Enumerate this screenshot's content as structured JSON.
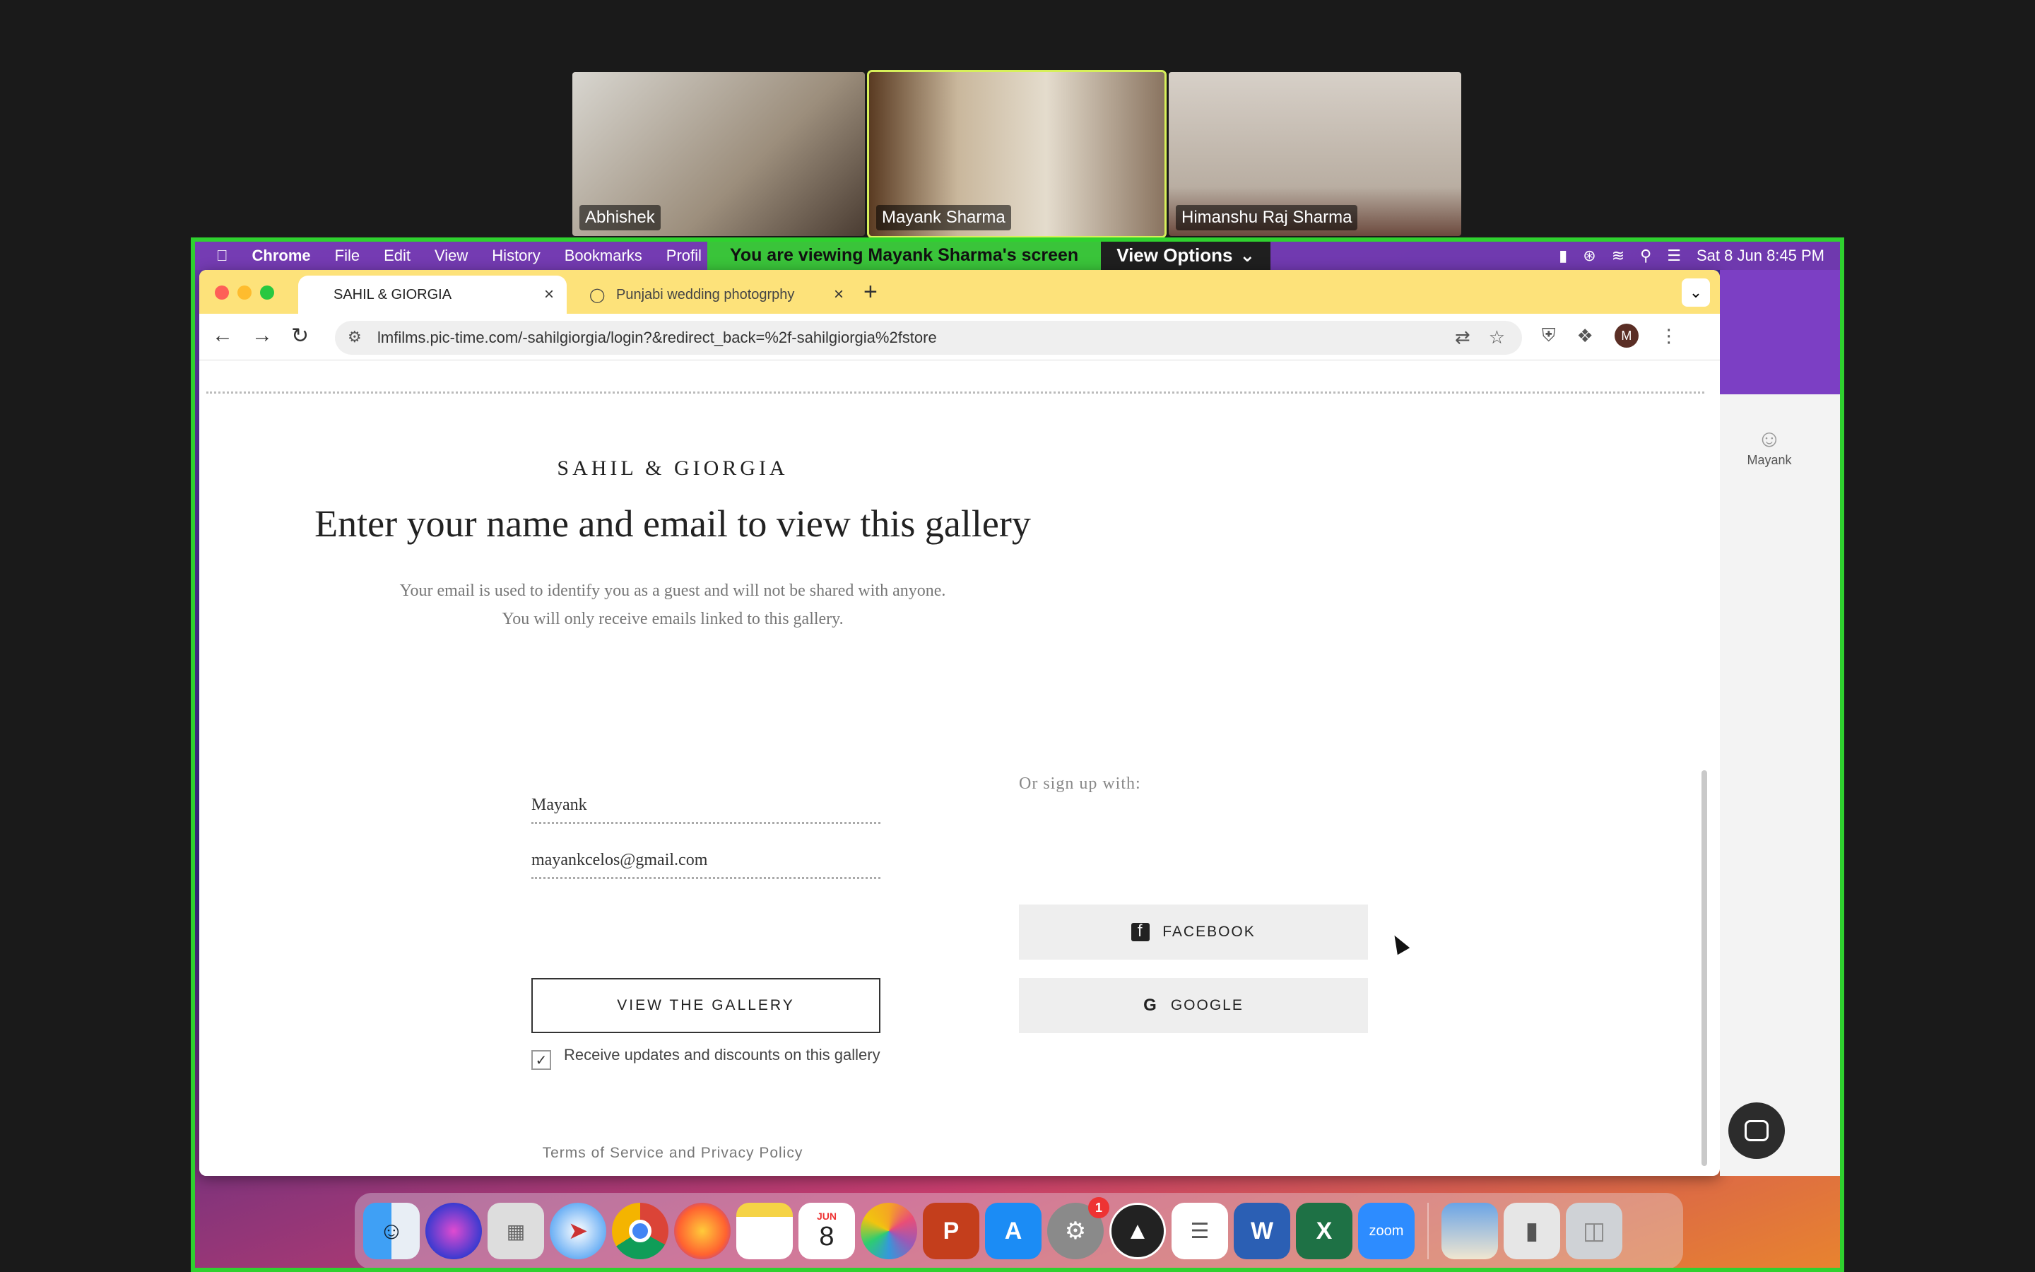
{
  "zoom": {
    "participants": [
      {
        "name": "Abhishek"
      },
      {
        "name": "Mayank Sharma"
      },
      {
        "name": "Himanshu Raj Sharma"
      }
    ],
    "banner_text": "You are viewing  Mayank Sharma's screen",
    "view_options_label": "View Options",
    "accent_color": "#2fd12f"
  },
  "mac_menubar": {
    "app": "Chrome",
    "menus": [
      "File",
      "Edit",
      "View",
      "History",
      "Bookmarks",
      "Profil"
    ],
    "datetime": "Sat 8 Jun  8:45 PM"
  },
  "browser": {
    "tabs": [
      {
        "title": "SAHIL & GIORGIA",
        "active": true
      },
      {
        "title": "Punjabi wedding photogrphy",
        "active": false
      }
    ],
    "url": "lmfilms.pic-time.com/-sahilgiorgia/login?&redirect_back=%2f-sahilgiorgia%2fstore",
    "profile_initial": "M"
  },
  "page": {
    "brand": "SAHIL & GIORGIA",
    "headline": "Enter your name and email to view this gallery",
    "subtext_line1": "Your email is used to identify you as a guest and will not be shared with anyone.",
    "subtext_line2": "You will only receive emails linked to this gallery.",
    "name_value": "Mayank",
    "email_value": "mayankcelos@gmail.com",
    "view_button": "VIEW THE GALLERY",
    "checkbox_label": "Receive updates and discounts on this gallery",
    "checkbox_checked": true,
    "or_sign_up": "Or sign up with:",
    "facebook_label": "FACEBOOK",
    "google_label": "GOOGLE",
    "terms": "Terms of Service and Privacy Policy"
  },
  "side_window": {
    "user_label": "Mayank"
  },
  "dock": {
    "calendar_month": "JUN",
    "calendar_day": "8",
    "settings_badge": "1",
    "zoom_label": "zoom"
  }
}
